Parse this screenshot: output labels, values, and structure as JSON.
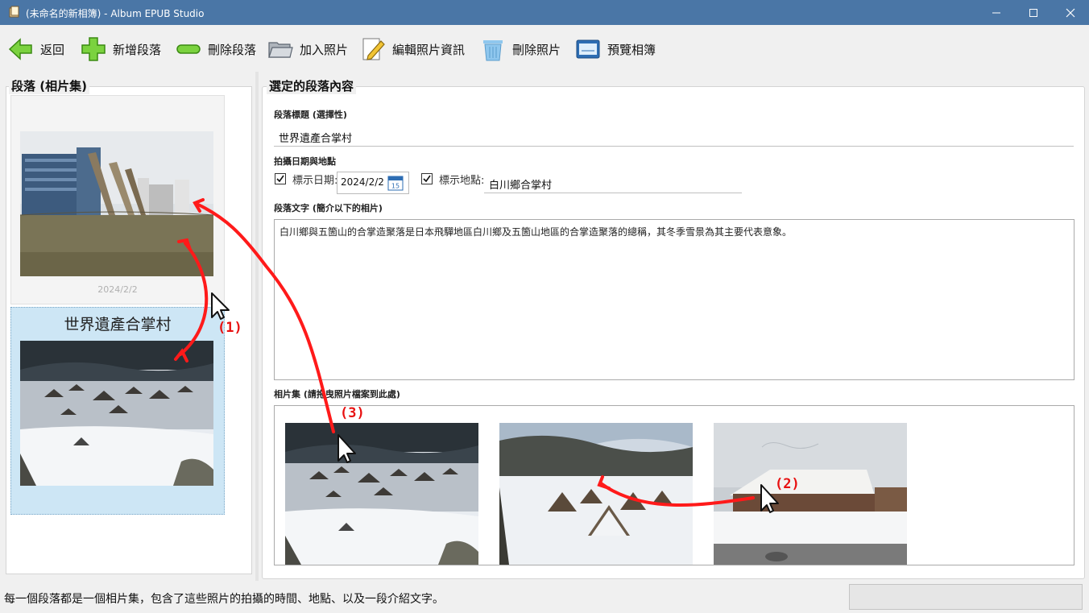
{
  "window": {
    "title": "(未命名的新相簿) - Album EPUB Studio",
    "minimize_icon": "minimize-icon",
    "maximize_icon": "maximize-icon",
    "close_icon": "close-icon"
  },
  "toolbar": {
    "back": "返回",
    "add_section": "新增段落",
    "delete_section": "刪除段落",
    "add_photo": "加入照片",
    "edit_photo_info": "編輯照片資訊",
    "delete_photo": "刪除照片",
    "preview_album": "預覽相簿"
  },
  "left": {
    "group_title": "段落 (相片集)",
    "sections": [
      {
        "date": "2024/2/2"
      },
      {
        "title": "世界遺產合掌村"
      }
    ]
  },
  "right": {
    "group_title": "選定的段落內容",
    "title_label": "段落標題 (選擇性)",
    "title_value": "世界遺產合掌村",
    "date_place_label": "拍攝日期與地點",
    "show_date_label": "標示日期:",
    "date_value": "2024/2/2",
    "calendar_day": "15",
    "show_place_label": "標示地點:",
    "place_value": "白川鄉合掌村",
    "text_label": "段落文字 (簡介以下的相片)",
    "text_value": "白川鄉與五箇山的合掌造聚落是日本飛驒地區白川鄉及五箇山地區的合掌造聚落的總稱，其冬季雪景為其主要代表意象。",
    "photos_label": "相片集 (請拖曳照片檔案到此處)"
  },
  "annotations": {
    "a1": "(1)",
    "a2": "(2)",
    "a3": "(3)"
  },
  "status": {
    "text": "每一個段落都是一個相片集，包含了這些照片的拍攝的時間、地點、以及一段介紹文字。"
  },
  "colors": {
    "titlebar": "#4a76a6",
    "selection": "#cde6f5",
    "arrow": "#ff0000"
  }
}
